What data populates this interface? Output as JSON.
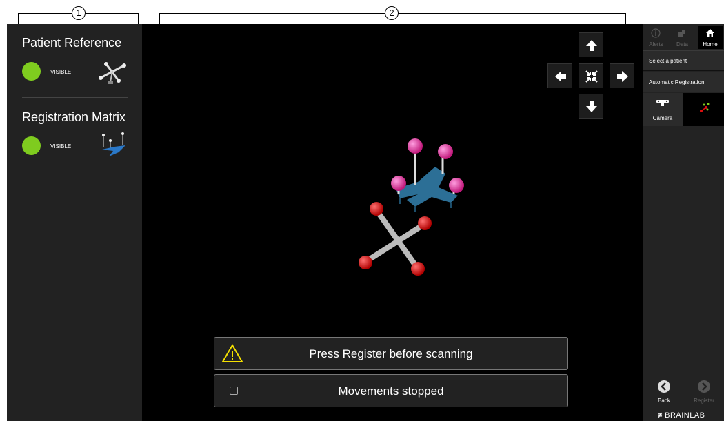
{
  "callouts": [
    "1",
    "2"
  ],
  "left_panel": {
    "patient_reference": {
      "title": "Patient Reference",
      "status": "VISIBLE",
      "icon": "patient-reference-star-icon"
    },
    "registration_matrix": {
      "title": "Registration Matrix",
      "status": "VISIBLE",
      "icon": "registration-matrix-icon"
    },
    "status_color": "#7fcc1f"
  },
  "viewport": {
    "nav": [
      "arrow-up-icon",
      "arrow-left-icon",
      "reset-view-icon",
      "arrow-right-icon",
      "arrow-down-icon"
    ],
    "messages": {
      "register_warning": "Press Register before scanning",
      "movements": "Movements stopped"
    }
  },
  "right_panel": {
    "tabs": {
      "alerts": "Alerts",
      "data": "Data",
      "home": "Home"
    },
    "menu": {
      "select_patient": "Select a patient",
      "automatic_registration": "Automatic Registration"
    },
    "camera_label": "Camera",
    "back_label": "Back",
    "register_label": "Register",
    "brand": "BRAINLAB"
  }
}
